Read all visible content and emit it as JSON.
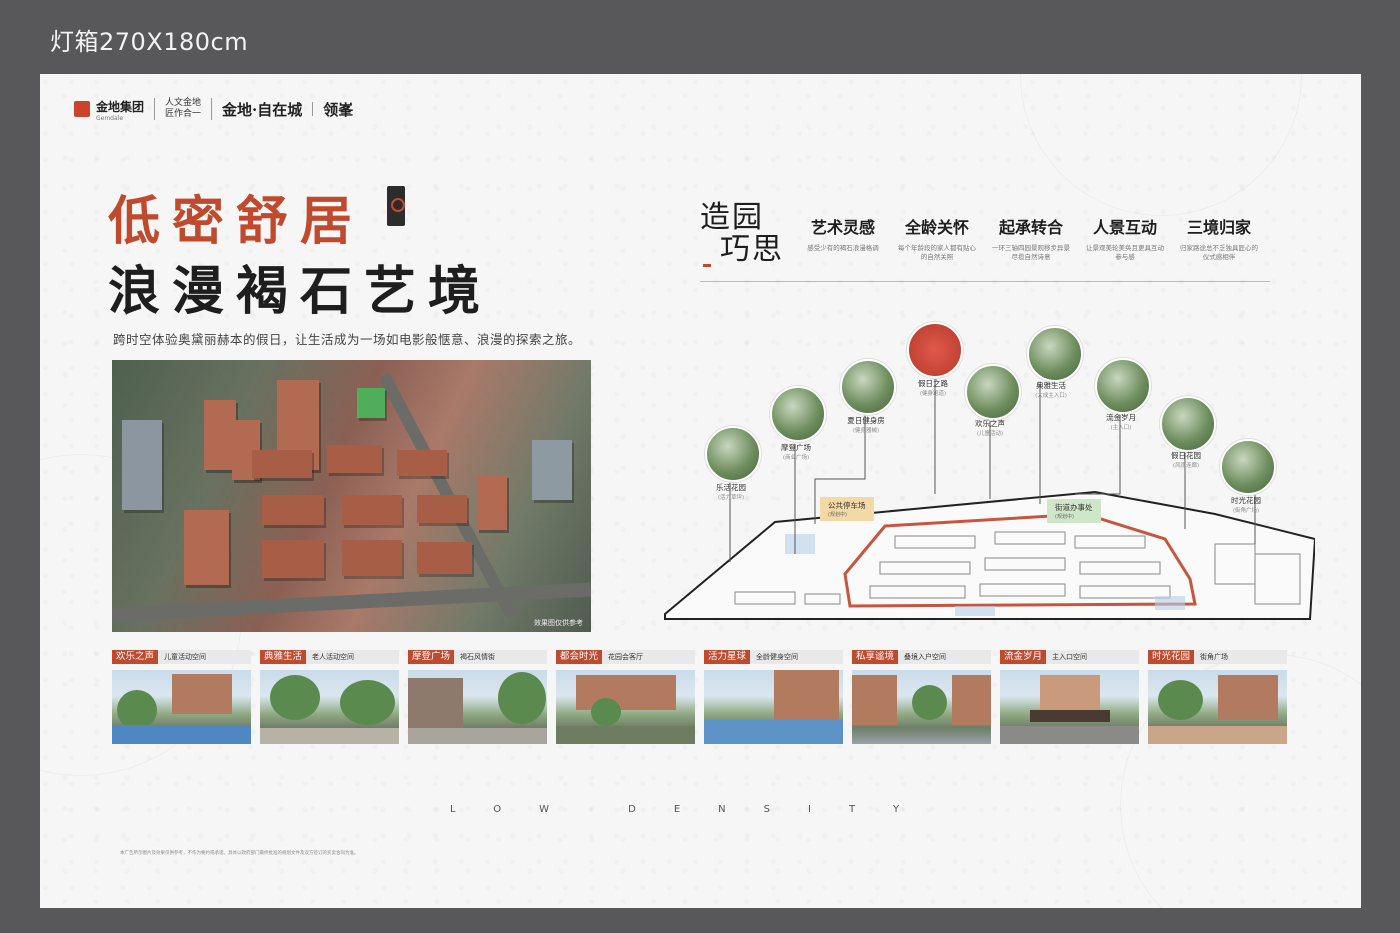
{
  "header": {
    "label": "灯箱270X180cm"
  },
  "logos": {
    "brand": "金地集团",
    "brand_en": "Gemdale",
    "slogan_line1": "人文金地",
    "slogan_line2": "匠作合一",
    "project": "金地·自在城",
    "project_sub": "领峯"
  },
  "headline": {
    "line1": "低密舒居",
    "line2": "浪漫褐石艺境",
    "subtitle": "跨时空体验奥黛丽赫本的假日，让生活成为一场如电影般惬意、浪漫的探索之旅。"
  },
  "aerial": {
    "caption": "效果图仅供参考"
  },
  "garden": {
    "title_line1": "造园",
    "title_line2": "巧思",
    "features": [
      {
        "title": "艺术灵感",
        "desc": "感受少有的褐石浪漫格调"
      },
      {
        "title": "全龄关怀",
        "desc": "每个年龄段的家人都有贴心的自然关照"
      },
      {
        "title": "起承转合",
        "desc": "一环三轴四园景观移步异景尽揽自然诗意"
      },
      {
        "title": "人景互动",
        "desc": "让景观美轮美奂且更具互动参与感"
      },
      {
        "title": "三境归家",
        "desc": "归家路途总不乏独具匠心的仪式感相伴"
      }
    ]
  },
  "siteplan": {
    "points": [
      {
        "name": "乐活花园",
        "sub": "(活力草坪)"
      },
      {
        "name": "摩登广场",
        "sub": "(商业广场)"
      },
      {
        "name": "夏日健身房",
        "sub": "(健身器械)"
      },
      {
        "name": "假日之路",
        "sub": "(健身跑道)"
      },
      {
        "name": "欢乐之声",
        "sub": "(儿童活动)"
      },
      {
        "name": "典雅生活",
        "sub": "(大成主入口)"
      },
      {
        "name": "流金岁月",
        "sub": "(主入口)"
      },
      {
        "name": "假日花园",
        "sub": "(风雨连廊)"
      },
      {
        "name": "时光花园",
        "sub": "(街角广场)"
      }
    ],
    "tags": [
      {
        "name": "公共停车场",
        "sub": "(规划中)"
      },
      {
        "name": "街道办事处",
        "sub": "(规划中)"
      }
    ]
  },
  "strip": [
    {
      "tag": "欢乐之声",
      "sub": "儿童活动空间"
    },
    {
      "tag": "典雅生活",
      "sub": "老人活动空间"
    },
    {
      "tag": "摩登广场",
      "sub": "褐石风情街"
    },
    {
      "tag": "都会时光",
      "sub": "花园会客厅"
    },
    {
      "tag": "活力星球",
      "sub": "全龄健身空间"
    },
    {
      "tag": "私享谧境",
      "sub": "叠境入户空间"
    },
    {
      "tag": "流金岁月",
      "sub": "主入口空间"
    },
    {
      "tag": "时光花园",
      "sub": "街角广场"
    }
  ],
  "footer": {
    "low_density": "LOW DENSITY",
    "fine_print": "本广告所示图片及效果仅供参考，不作为要约或承诺。具体以政府部门最终批准的规划文件及双方签订的买卖合同为准。"
  }
}
